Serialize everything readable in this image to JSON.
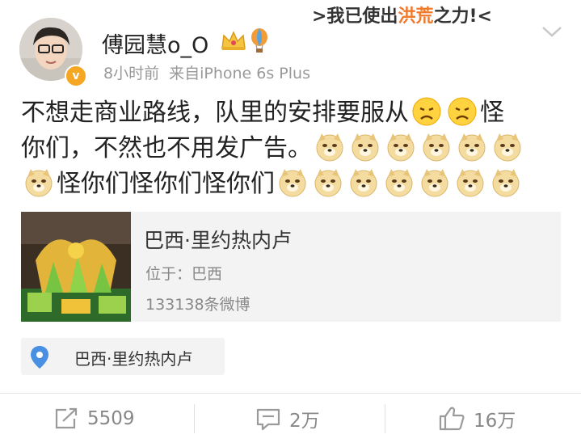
{
  "post": {
    "username": "傅园慧o_O",
    "time": "8小时前",
    "source": "来自iPhone 6s Plus",
    "sticker_text": {
      "pre": ">我已使出",
      "hl": "洪荒",
      "post": "之力!<"
    },
    "text_1": "不想走商业路线，队里的安排要服从",
    "text_2": "怪",
    "text_3": "你们，不然也不用发广告。",
    "text_4": "怪你们怪你们怪你们"
  },
  "location_card": {
    "title": "巴西·里约热内卢",
    "location": "位于：巴西",
    "count": "133138条微博"
  },
  "location_tag": {
    "label": "巴西·里约热内卢"
  },
  "actions": {
    "repost": "5509",
    "comment": "2万",
    "like": "16万"
  },
  "colors": {
    "accent": "#f5a623",
    "meta_gray": "#999999",
    "card_bg": "#f3f3f3",
    "pin_blue": "#4a90e2"
  }
}
